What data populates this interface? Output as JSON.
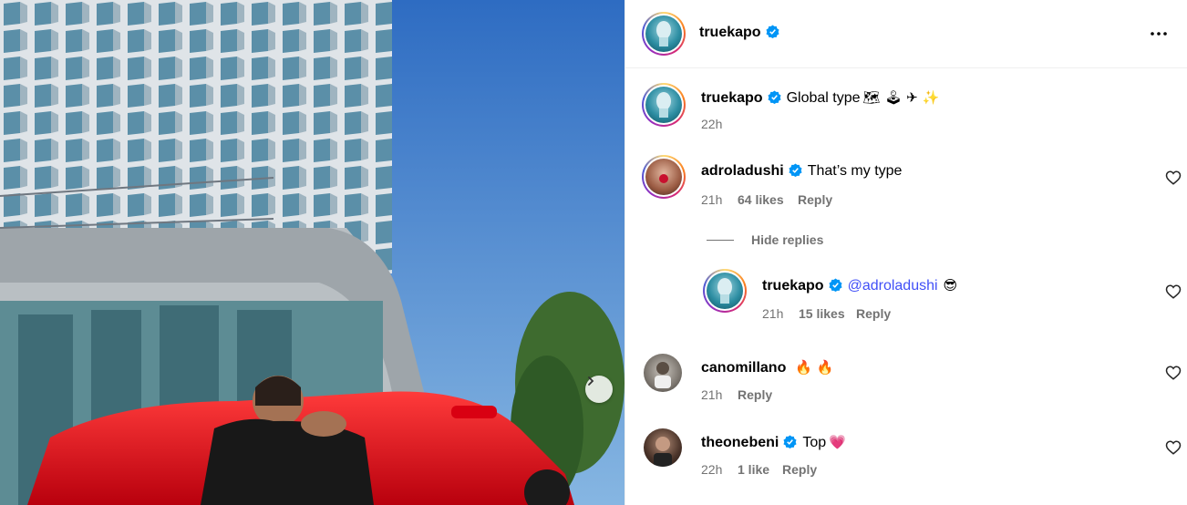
{
  "post": {
    "author": "truekapo",
    "more_icon": "more-horizontal-icon"
  },
  "caption": {
    "username": "truekapo",
    "text": "Global type",
    "emojis": "🗺 🕹 ✈ ✨",
    "time": "22h"
  },
  "comments": [
    {
      "username": "adroladushi",
      "verified": true,
      "text": "That’s my type",
      "time": "21h",
      "likes": "64 likes",
      "reply": "Reply"
    },
    {
      "username": "canomillano",
      "verified": false,
      "text": "🔥 🔥",
      "time": "21h",
      "likes": "",
      "reply": "Reply"
    },
    {
      "username": "theonebeni",
      "verified": true,
      "text": "Top",
      "emoji": "💗",
      "time": "22h",
      "likes": "1 like",
      "reply": "Reply"
    }
  ],
  "replies_toggle": "Hide replies",
  "reply": {
    "username": "truekapo",
    "mention": "@adroladushi",
    "emoji": "😎",
    "time": "21h",
    "likes": "15 likes",
    "reply": "Reply"
  },
  "colors": {
    "verified": "#0095f6",
    "meta": "#737373",
    "mention": "#4150f7"
  }
}
